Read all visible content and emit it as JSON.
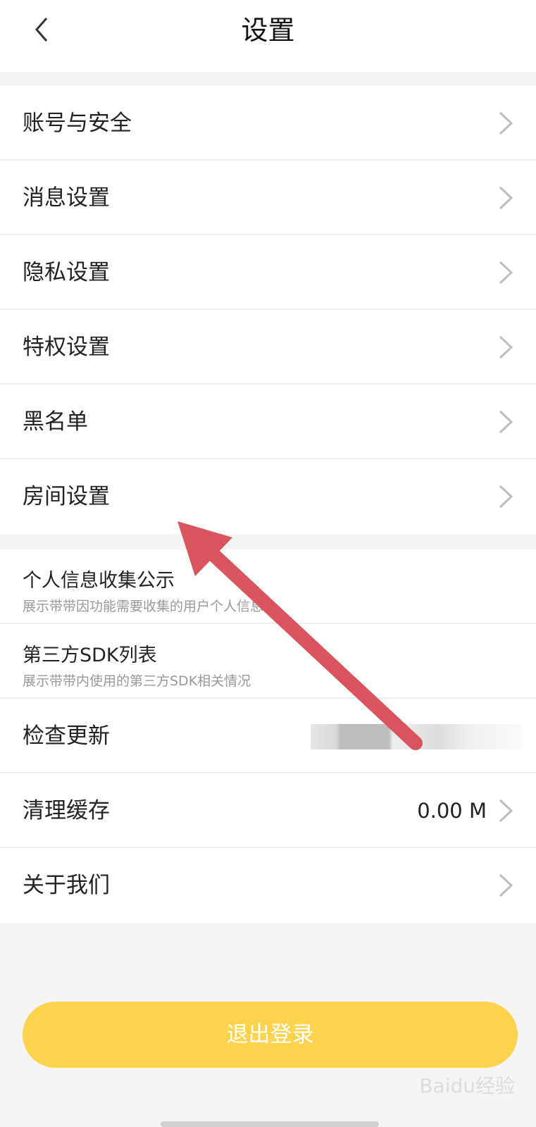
{
  "header": {
    "title": "设置"
  },
  "group1": [
    {
      "label": "账号与安全"
    },
    {
      "label": "消息设置"
    },
    {
      "label": "隐私设置"
    },
    {
      "label": "特权设置"
    },
    {
      "label": "黑名单"
    },
    {
      "label": "房间设置"
    }
  ],
  "group2": [
    {
      "label": "个人信息收集公示",
      "sub": "展示带带因功能需要收集的用户个人信息"
    },
    {
      "label": "第三方SDK列表",
      "sub": "展示带带内使用的第三方SDK相关情况"
    },
    {
      "label": "检查更新"
    },
    {
      "label": "清理缓存",
      "value": "0.00 M"
    },
    {
      "label": "关于我们"
    }
  ],
  "logout": {
    "label": "退出登录"
  },
  "watermark": {
    "text": "Baidu经验"
  },
  "colors": {
    "accent": "#fcd34d",
    "annotation_arrow": "#d9545e"
  }
}
